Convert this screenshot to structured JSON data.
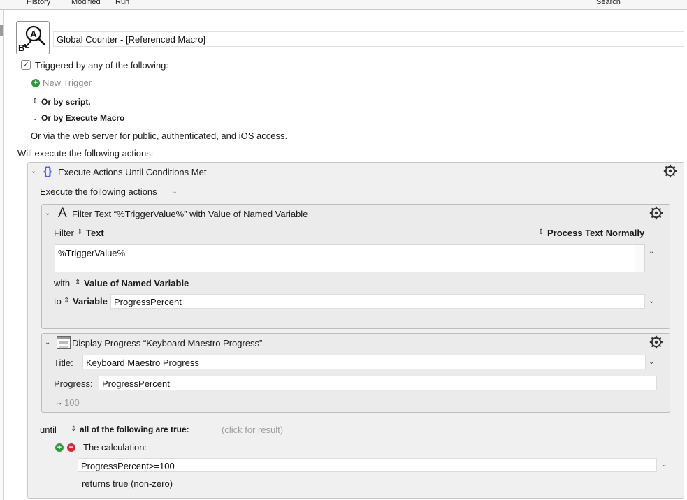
{
  "toolbar": {
    "history": "History",
    "modified": "Modified",
    "run": "Run",
    "search": "Search"
  },
  "macro": {
    "name": "Global Counter - [Referenced Macro]",
    "icon": "macro-ab-magnifier-icon"
  },
  "triggers": {
    "checked": true,
    "label": "Triggered by any of the following:",
    "new_trigger": "New Trigger",
    "or_by_script": "Or by script.",
    "or_by_execute_macro": "Or by Execute Macro",
    "web_server": "Or via the web server for public, authenticated, and iOS access."
  },
  "will_execute": "Will execute the following actions:",
  "until_action": {
    "title": "Execute Actions Until Conditions Met",
    "execute_label": "Execute the following actions",
    "until_label": "until",
    "condition_mode": "all of the following are true:",
    "click_for_result": "(click for result)",
    "calculation_label": "The calculation:",
    "calculation_value": "ProgressPercent>=100",
    "returns_label": "returns true (non-zero)"
  },
  "filter_action": {
    "title": "Filter Text “%TriggerValue%” with Value of Named Variable",
    "filter_label": "Filter",
    "source_type": "Text",
    "process_mode": "Process Text Normally",
    "text_value": "%TriggerValue%",
    "with_label": "with",
    "filter_type": "Value of Named Variable",
    "to_label": "to",
    "dest_type": "Variable",
    "dest_value": "ProgressPercent"
  },
  "progress_action": {
    "title": "Display Progress “Keyboard Maestro Progress”",
    "title_label": "Title:",
    "title_value": "Keyboard Maestro Progress",
    "progress_label": "Progress:",
    "progress_value": "ProgressPercent",
    "result_arrow": "→",
    "result_value": "100"
  },
  "icons": {
    "gear": "gear-icon",
    "chevron_down": "chevron-down-icon",
    "updown": "updown-arrows-icon"
  }
}
